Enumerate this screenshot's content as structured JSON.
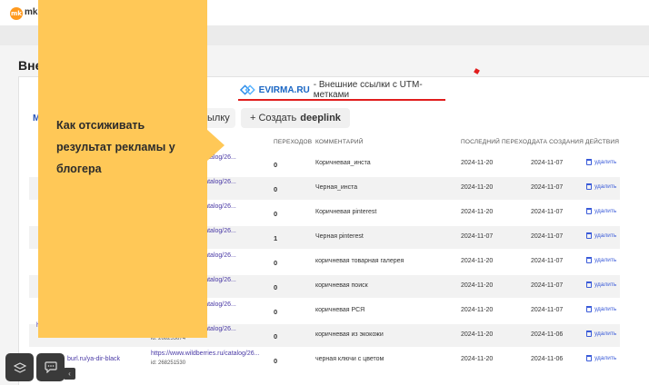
{
  "topbar": {
    "logo_badge": "mk",
    "logo_text": "mke"
  },
  "page": {
    "title": "Вне"
  },
  "banner": {
    "brand": "EVIRMA.RU",
    "subtitle": "- Внешние ссылки с UTM-метками"
  },
  "tabs": {
    "first_fragment": "М",
    "create_link_fragment": "ылку",
    "create_deeplink_prefix": "+ Создать",
    "create_deeplink_bold": "deeplink"
  },
  "table": {
    "headers": [
      "ПЕРЕХОДОВ",
      "КОММЕНТАРИЙ",
      "ПОСЛЕДНИЙ ПЕРЕХОД",
      "ДАТА СОЗДАНИЯ",
      "ДЕЙСТВИЯ"
    ],
    "delete_label": "удалить",
    "rows": [
      {
        "url": "rries.ru/catalog/26...",
        "count": "0",
        "comment": "Коричневая_инста",
        "last": "2024-11-20",
        "created": "2024-11-07"
      },
      {
        "url": "rries.ru/catalog/26...",
        "count": "0",
        "comment": "Черная_инста",
        "last": "2024-11-20",
        "created": "2024-11-07"
      },
      {
        "url": "rries.ru/catalog/26...",
        "count": "0",
        "comment": "Коричневая pinterest",
        "last": "2024-11-20",
        "created": "2024-11-07"
      },
      {
        "url": "rries.ru/catalog/26...",
        "count": "1",
        "comment": "Черная pinterest",
        "last": "2024-11-07",
        "created": "2024-11-07"
      },
      {
        "url": "rries.ru/catalog/26...",
        "count": "0",
        "comment": "коричневая товарная галерея",
        "last": "2024-11-20",
        "created": "2024-11-07"
      },
      {
        "url": "rries.ru/catalog/26...",
        "count": "0",
        "comment": "коричневая поиск",
        "last": "2024-11-20",
        "created": "2024-11-07"
      },
      {
        "url": "rries.ru/catalog/26...",
        "count": "0",
        "comment": "коричневая РСЯ",
        "last": "2024-11-20",
        "created": "2024-11-07"
      },
      {
        "url": "rries.ru/catalog/26...",
        "count": "0",
        "comment": "коричневая из экокожи",
        "last": "2024-11-20",
        "created": "2024-11-06",
        "sub_left": "https://burl.ru/ya-dir-koricht",
        "sub_id": "id: 268255674"
      },
      {
        "url": "https://www.wildberries.ru/catalog/26...",
        "count": "0",
        "comment": "черная ключи с цветом",
        "last": "2024-11-20",
        "created": "2024-11-06",
        "short": "burl.ru/ya-dir-black",
        "sub_id": "id: 268251530"
      }
    ]
  },
  "callout": {
    "text": "Как отсиживать результат рекламы у блогера"
  }
}
